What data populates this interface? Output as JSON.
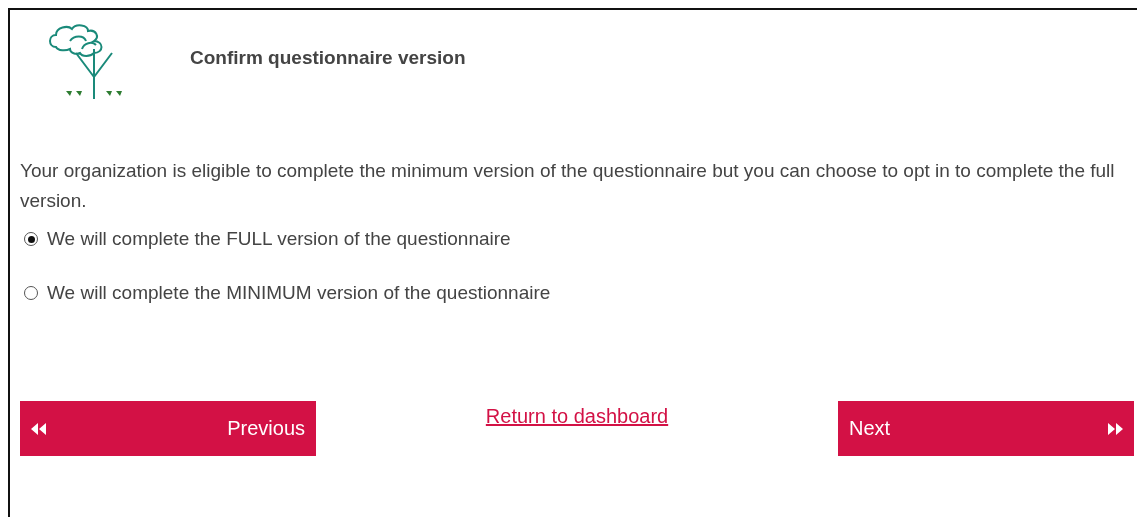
{
  "header": {
    "title": "Confirm questionnaire version"
  },
  "intro": "Your organization is eligible to complete the minimum version of the questionnaire but you can choose to opt in to complete the full version.",
  "options": [
    {
      "label": "We will complete the FULL version of the questionnaire",
      "selected": true
    },
    {
      "label": "We will complete the MINIMUM version of the questionnaire",
      "selected": false
    }
  ],
  "nav": {
    "previous": "Previous",
    "link": "Return to dashboard",
    "next": "Next"
  }
}
